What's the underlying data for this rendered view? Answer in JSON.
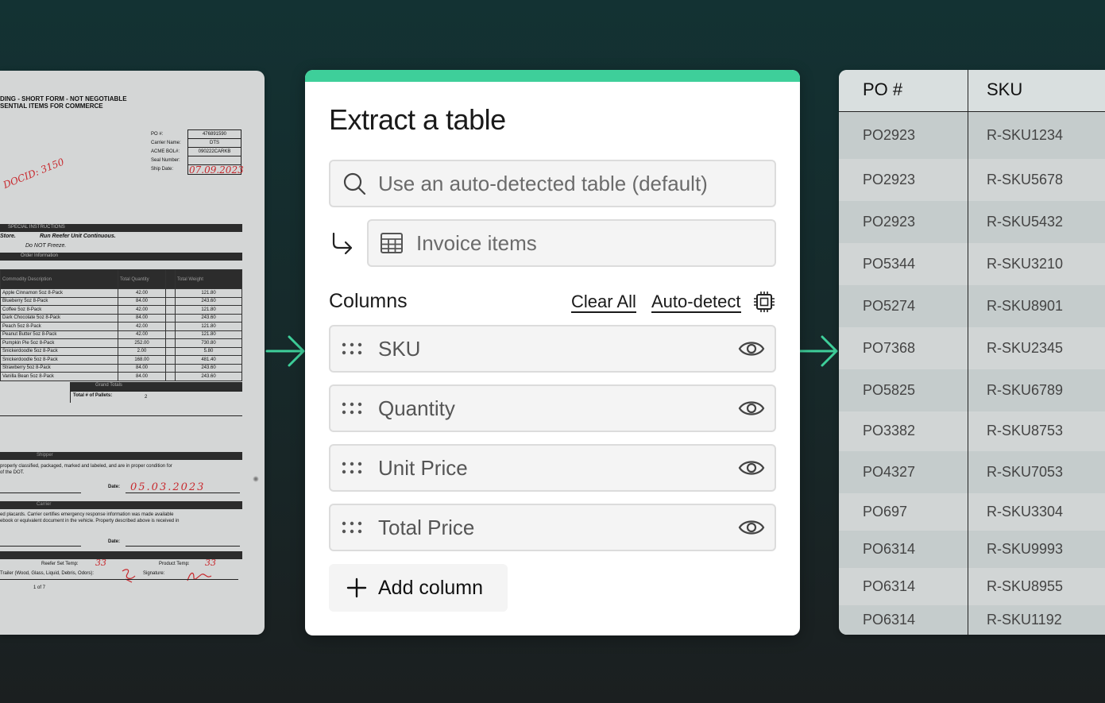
{
  "document": {
    "header_line1": "DING - SHORT FORM - NOT NEGOTIABLE",
    "header_line2": "SENTIAL ITEMS FOR COMMERCE",
    "fields": [
      {
        "label": "PO #:",
        "value": "476891590"
      },
      {
        "label": "Carrier Name:",
        "value": "DTS"
      },
      {
        "label": "ACME BOL#:",
        "value": "090222CARKB"
      },
      {
        "label": "Seal Number:",
        "value": ""
      },
      {
        "label": "Ship Date:",
        "value": ""
      }
    ],
    "handwritten_date": "07.09.2023",
    "handwritten_docid": "DOCID: 3150",
    "special_instructions": "SPECIAL INSTRUCTIONS",
    "instr_store": "Store.",
    "instr_line1": "Run Reefer Unit Continuous.",
    "instr_line2": "Do NOT Freeze.",
    "order_info": "Order Information",
    "col_desc": "Commodity Description",
    "col_total": "Total Quantity",
    "col_weight": "Total Weight",
    "items": [
      {
        "desc": "Apple Cinnamon 5oz 8-Pack",
        "qty": "42.00",
        "wt": "121.80"
      },
      {
        "desc": "Blueberry 5oz 8-Pack",
        "qty": "84.00",
        "wt": "243.60"
      },
      {
        "desc": "Coffee 5oz 8-Pack",
        "qty": "42.00",
        "wt": "121.80"
      },
      {
        "desc": "Dark Chocolate 5oz 8-Pack",
        "qty": "84.00",
        "wt": "243.60"
      },
      {
        "desc": "Peach 5oz 8-Pack",
        "qty": "42.00",
        "wt": "121.80"
      },
      {
        "desc": "Peanut Butter 5oz 8-Pack",
        "qty": "42.00",
        "wt": "121.80"
      },
      {
        "desc": "Pumpkin Pie 5oz 8-Pack",
        "qty": "252.00",
        "wt": "730.80"
      },
      {
        "desc": "Snickerdoodle 5oz 8-Pack",
        "qty": "2.00",
        "wt": "5.80"
      },
      {
        "desc": "Snickerdoodle 5oz 8-Pack",
        "qty": "168.00",
        "wt": "481.40"
      },
      {
        "desc": "Strawberry 5oz 8-Pack",
        "qty": "84.00",
        "wt": "243.60"
      },
      {
        "desc": "Vanilla Bean 5oz 8-Pack",
        "qty": "84.00",
        "wt": "243.60"
      }
    ],
    "grand_totals": "Grand Totals",
    "pallets_label": "Total # of Pallets:",
    "pallets_value": "2",
    "shipper": "Shipper",
    "shipper_text1": "properly classified, packaged, marked and labeled, and are in proper condition for",
    "shipper_text2": "of the DOT.",
    "date_label": "Date:",
    "handwritten_date2": "05.03.2023",
    "carrier": "Carrier",
    "carrier_text1": "ed placards. Carrier certifies emergency response information was made available",
    "carrier_text2": "ebook or equivalent document in the vehicle. Property described above is received in",
    "date_label2": "Date:",
    "reefer_label": "Reefer Set Temp:",
    "reefer_value": "33",
    "product_label": "Product Temp:",
    "product_value": "33",
    "trailer_label": "Trailer (Wood, Glass, Liquid, Debris, Odors):",
    "signature_label": "Signature:",
    "page": "1 of 7"
  },
  "panel": {
    "title": "Extract a table",
    "search_placeholder": "Use an auto-detected table (default)",
    "selected_table": "Invoice items",
    "columns_label": "Columns",
    "clear_all": "Clear All",
    "auto_detect": "Auto-detect",
    "columns": [
      "SKU",
      "Quantity",
      "Unit Price",
      "Total Price"
    ],
    "add_column": "Add column",
    "accent_color": "#3ecf9a"
  },
  "result_table": {
    "headers": [
      "PO #",
      "SKU"
    ],
    "rows": [
      [
        "PO2923",
        "R-SKU1234"
      ],
      [
        "PO2923",
        "R-SKU5678"
      ],
      [
        "PO2923",
        "R-SKU5432"
      ],
      [
        "PO5344",
        "R-SKU3210"
      ],
      [
        "PO5274",
        "R-SKU8901"
      ],
      [
        "PO7368",
        "R-SKU2345"
      ],
      [
        "PO5825",
        "R-SKU6789"
      ],
      [
        "PO3382",
        "R-SKU8753"
      ],
      [
        "PO4327",
        "R-SKU7053"
      ],
      [
        "PO697",
        "R-SKU3304"
      ],
      [
        "PO6314",
        "R-SKU9993"
      ],
      [
        "PO6314",
        "R-SKU8955"
      ],
      [
        "PO6314",
        "R-SKU1192"
      ]
    ]
  }
}
